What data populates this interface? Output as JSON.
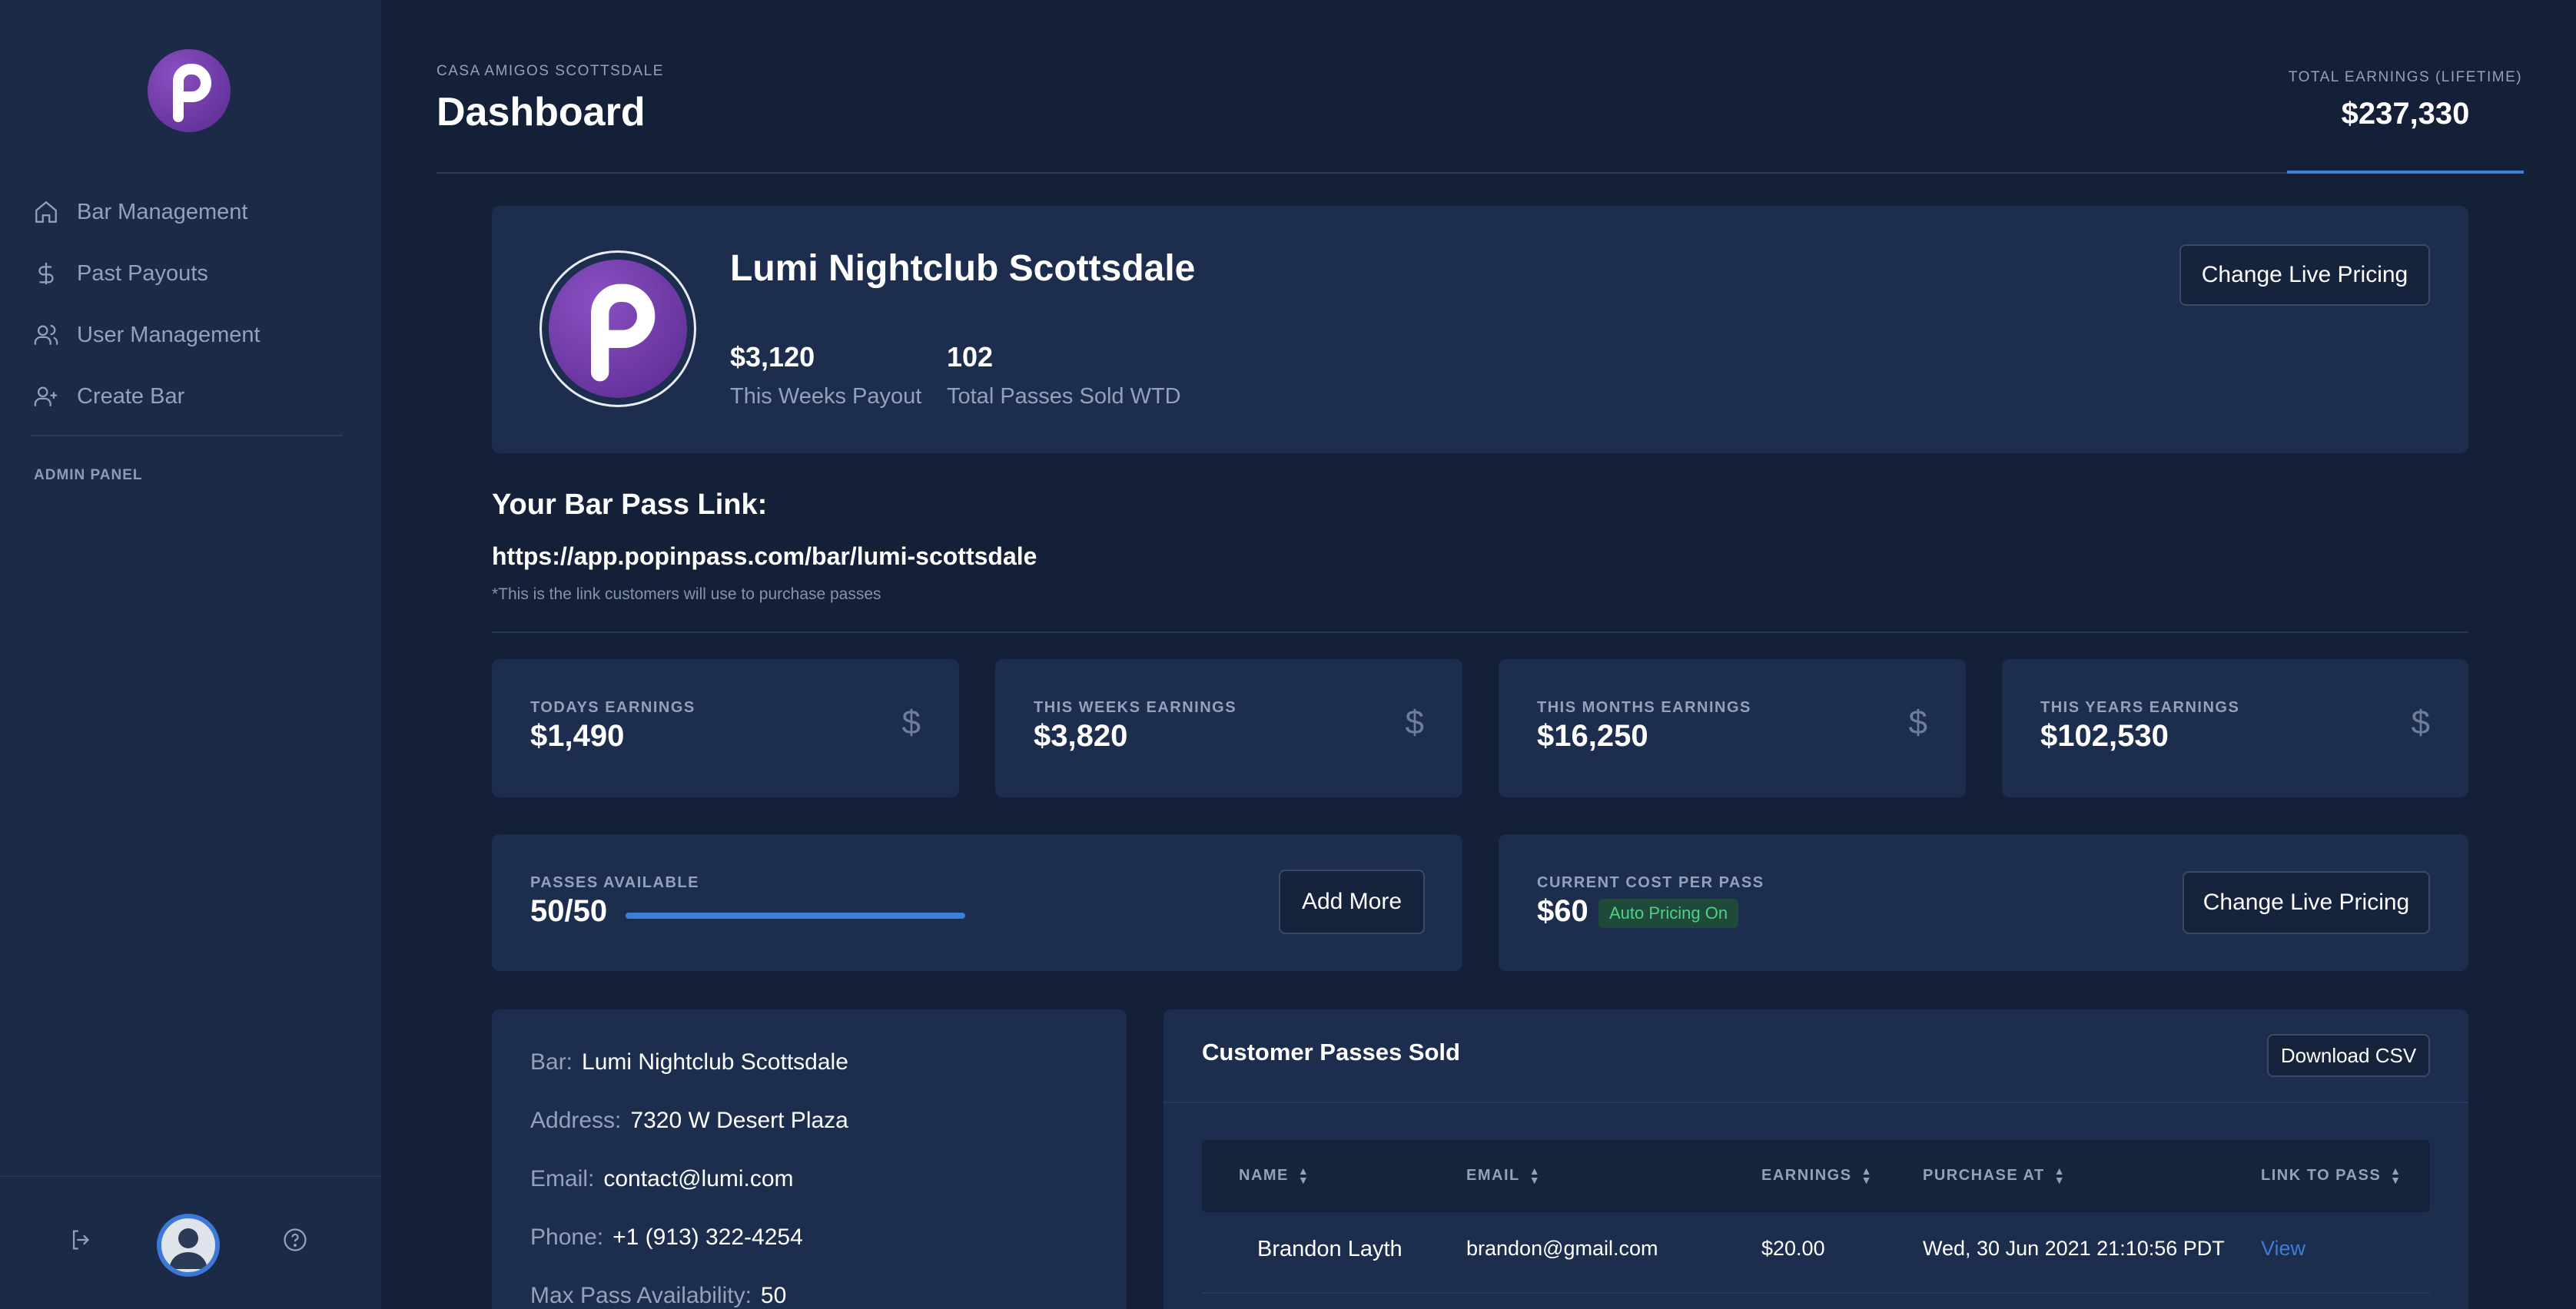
{
  "colors": {
    "sidebar_bg": "#1a2a47",
    "page_bg": "#142038",
    "card_bg": "#1c2d4d",
    "accent_blue": "#3b7dd8",
    "brand_purple": "#6a37a8",
    "success_green": "#4fd08a"
  },
  "sidebar": {
    "logo_icon": "popinpass-logo",
    "items": [
      {
        "label": "Bar Management",
        "icon": "home-icon"
      },
      {
        "label": "Past Payouts",
        "icon": "dollar-icon"
      },
      {
        "label": "User Management",
        "icon": "users-icon"
      },
      {
        "label": "Create Bar",
        "icon": "user-plus-icon"
      }
    ],
    "admin_label": "ADMIN PANEL",
    "bottom_icons": [
      "logout-icon",
      "avatar",
      "help-icon"
    ]
  },
  "header": {
    "venue": "CASA AMIGOS SCOTTSDALE",
    "title": "Dashboard",
    "total_label": "TOTAL EARNINGS (LIFETIME)",
    "total_value": "$237,330"
  },
  "venue_card": {
    "name": "Lumi Nightclub Scottsdale",
    "payout_value": "$3,120",
    "payout_label": "This Weeks Payout",
    "passes_value": "102",
    "passes_label": "Total Passes Sold WTD",
    "button": "Change Live Pricing"
  },
  "pass_link": {
    "title": "Your Bar Pass Link:",
    "url": "https://app.popinpass.com/bar/lumi-scottsdale",
    "note": "*This is the link customers will use to purchase passes"
  },
  "earnings": [
    {
      "label": "TODAYS EARNINGS",
      "value": "$1,490",
      "icon": "$"
    },
    {
      "label": "THIS WEEKS EARNINGS",
      "value": "$3,820",
      "icon": "$"
    },
    {
      "label": "THIS MONTHS EARNINGS",
      "value": "$16,250",
      "icon": "$"
    },
    {
      "label": "THIS YEARS EARNINGS",
      "value": "$102,530",
      "icon": "$"
    }
  ],
  "passes": {
    "label": "PASSES AVAILABLE",
    "value": "50/50",
    "fill_fraction": 1.0,
    "button": "Add More"
  },
  "pricing": {
    "label": "CURRENT COST PER PASS",
    "value": "$60",
    "badge": "Auto Pricing On",
    "button": "Change Live Pricing"
  },
  "bar_info": {
    "rows": [
      {
        "key": "Bar:",
        "value": "Lumi Nightclub Scottsdale"
      },
      {
        "key": "Address:",
        "value": "7320 W Desert Plaza"
      },
      {
        "key": "Email:",
        "value": "contact@lumi.com"
      },
      {
        "key": "Phone:",
        "value": "+1 (913) 322-4254"
      },
      {
        "key": "Max Pass Availability:",
        "value": "50"
      }
    ]
  },
  "customer_table": {
    "title": "Customer Passes Sold",
    "download_button": "Download CSV",
    "columns": [
      "NAME",
      "EMAIL",
      "EARNINGS",
      "PURCHASE AT",
      "LINK TO PASS"
    ],
    "rows": [
      {
        "name": "Brandon Layth",
        "email": "brandon@gmail.com",
        "earnings": "$20.00",
        "purchase_at": "Wed, 30 Jun 2021 21:10:56 PDT",
        "link": "View"
      }
    ]
  }
}
